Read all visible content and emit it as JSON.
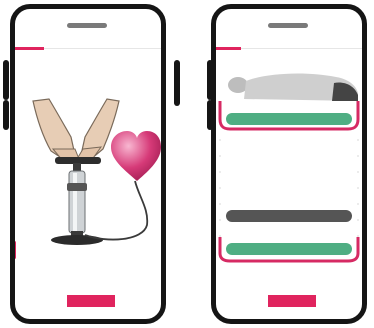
{
  "screens": [
    {
      "id": "inflate-screen",
      "progress_fraction": 0.2,
      "illustration": "hand-pump-inflating-heart-balloon",
      "icons": [
        "hands-icon",
        "air-pump-icon",
        "heart-balloon-icon"
      ]
    },
    {
      "id": "band-screen",
      "progress_fraction": 0.17,
      "illustration": "patient-lying-with-bands",
      "icons": [
        "lying-patient-icon"
      ]
    }
  ],
  "colors": {
    "accent": "#e0245e",
    "band_green": "#4fae83",
    "band_gray": "#555555",
    "frame": "#151515",
    "heart": "#d63a78"
  }
}
